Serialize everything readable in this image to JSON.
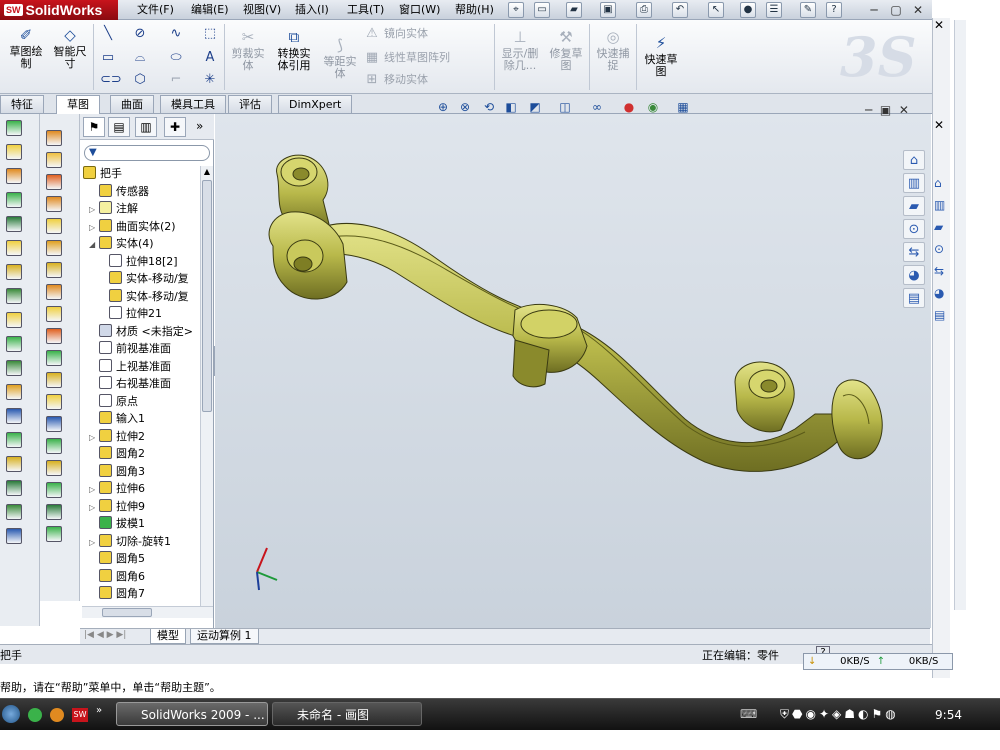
{
  "app": {
    "name": "SolidWorks"
  },
  "menu": [
    "文件(F)",
    "编辑(E)",
    "视图(V)",
    "插入(I)",
    "工具(T)",
    "窗口(W)",
    "帮助(H)"
  ],
  "ribbon": {
    "sketch_btn": [
      "草图绘",
      "制"
    ],
    "smart_dim_btn": [
      "智能尺",
      "寸"
    ],
    "trim_btn": [
      "剪裁实",
      "体"
    ],
    "convert_btn": [
      "转换实",
      "体引用"
    ],
    "offset_btn": [
      "等距实",
      "体"
    ],
    "mirror": "镜向实体",
    "linear_pattern": "线性草图阵列",
    "move": "移动实体",
    "show_delete_btn": [
      "显示/删",
      "除几..."
    ],
    "repair_btn": [
      "修复草",
      "图"
    ],
    "quick_snap_btn": [
      "快速捕",
      "捉"
    ],
    "rapid_sketch_btn": [
      "快速草",
      "图"
    ]
  },
  "tabs": [
    {
      "label": "特征",
      "active": false
    },
    {
      "label": "草图",
      "active": true
    },
    {
      "label": "曲面",
      "active": false
    },
    {
      "label": "模具工具",
      "active": false
    },
    {
      "label": "评估",
      "active": false
    },
    {
      "label": "DimXpert",
      "active": false
    }
  ],
  "tree": {
    "root": "把手",
    "items": [
      {
        "label": "传感器",
        "indent": 1,
        "expand": "",
        "color": "#f0d040"
      },
      {
        "label": "注解",
        "indent": 1,
        "expand": "▷",
        "color": "#f5f0a0"
      },
      {
        "label": "曲面实体(2)",
        "indent": 1,
        "expand": "▷",
        "color": "#f0d040"
      },
      {
        "label": "实体(4)",
        "indent": 1,
        "expand": "◢",
        "color": "#f0d040"
      },
      {
        "label": "拉伸18[2]",
        "indent": 2,
        "expand": "",
        "color": "#ffffff"
      },
      {
        "label": "实体-移动/复",
        "indent": 2,
        "expand": "",
        "color": "#f0d040"
      },
      {
        "label": "实体-移动/复",
        "indent": 2,
        "expand": "",
        "color": "#f0d040"
      },
      {
        "label": "拉伸21",
        "indent": 2,
        "expand": "",
        "color": "#ffffff"
      },
      {
        "label": "材质 <未指定>",
        "indent": 1,
        "expand": "",
        "color": "#d0d8e8"
      },
      {
        "label": "前视基准面",
        "indent": 1,
        "expand": "",
        "color": "#ffffff"
      },
      {
        "label": "上视基准面",
        "indent": 1,
        "expand": "",
        "color": "#ffffff"
      },
      {
        "label": "右视基准面",
        "indent": 1,
        "expand": "",
        "color": "#ffffff"
      },
      {
        "label": "原点",
        "indent": 1,
        "expand": "",
        "color": "#ffffff"
      },
      {
        "label": "输入1",
        "indent": 1,
        "expand": "",
        "color": "#f0d040"
      },
      {
        "label": "拉伸2",
        "indent": 1,
        "expand": "▷",
        "color": "#f0d040"
      },
      {
        "label": "圆角2",
        "indent": 1,
        "expand": "",
        "color": "#f0d040"
      },
      {
        "label": "圆角3",
        "indent": 1,
        "expand": "",
        "color": "#f0d040"
      },
      {
        "label": "拉伸6",
        "indent": 1,
        "expand": "▷",
        "color": "#f0d040"
      },
      {
        "label": "拉伸9",
        "indent": 1,
        "expand": "▷",
        "color": "#f0d040"
      },
      {
        "label": "拔模1",
        "indent": 1,
        "expand": "",
        "color": "#3ab24a"
      },
      {
        "label": "切除-旋转1",
        "indent": 1,
        "expand": "▷",
        "color": "#f0d040"
      },
      {
        "label": "圆角5",
        "indent": 1,
        "expand": "",
        "color": "#f0d040"
      },
      {
        "label": "圆角6",
        "indent": 1,
        "expand": "",
        "color": "#f0d040"
      },
      {
        "label": "圆角7",
        "indent": 1,
        "expand": "",
        "color": "#f0d040"
      }
    ]
  },
  "bottom_tabs": [
    "模型",
    "运动算例 1"
  ],
  "status": {
    "left": "把手",
    "editing": "正在编辑：零件"
  },
  "net": {
    "down": "0KB/S",
    "up": "0KB/S"
  },
  "help_text": "帮助，请在“帮助”菜单中，单击“帮助主题”。",
  "taskbar": {
    "tasks": [
      {
        "label": "SolidWorks 2009 - ...",
        "active": true
      },
      {
        "label": "未命名 - 画图",
        "active": false
      }
    ],
    "clock": "9:54"
  },
  "colors": {
    "model": "#b8b84a",
    "model_dark": "#6e6e22",
    "accent": "#c8141c"
  },
  "icons": [
    "search-icon",
    "zoom-icon",
    "rotate-icon",
    "section-icon",
    "view-orient-icon",
    "display-style-icon",
    "hide-show-icon",
    "appearance-icon",
    "scene-icon",
    "render-icon"
  ]
}
